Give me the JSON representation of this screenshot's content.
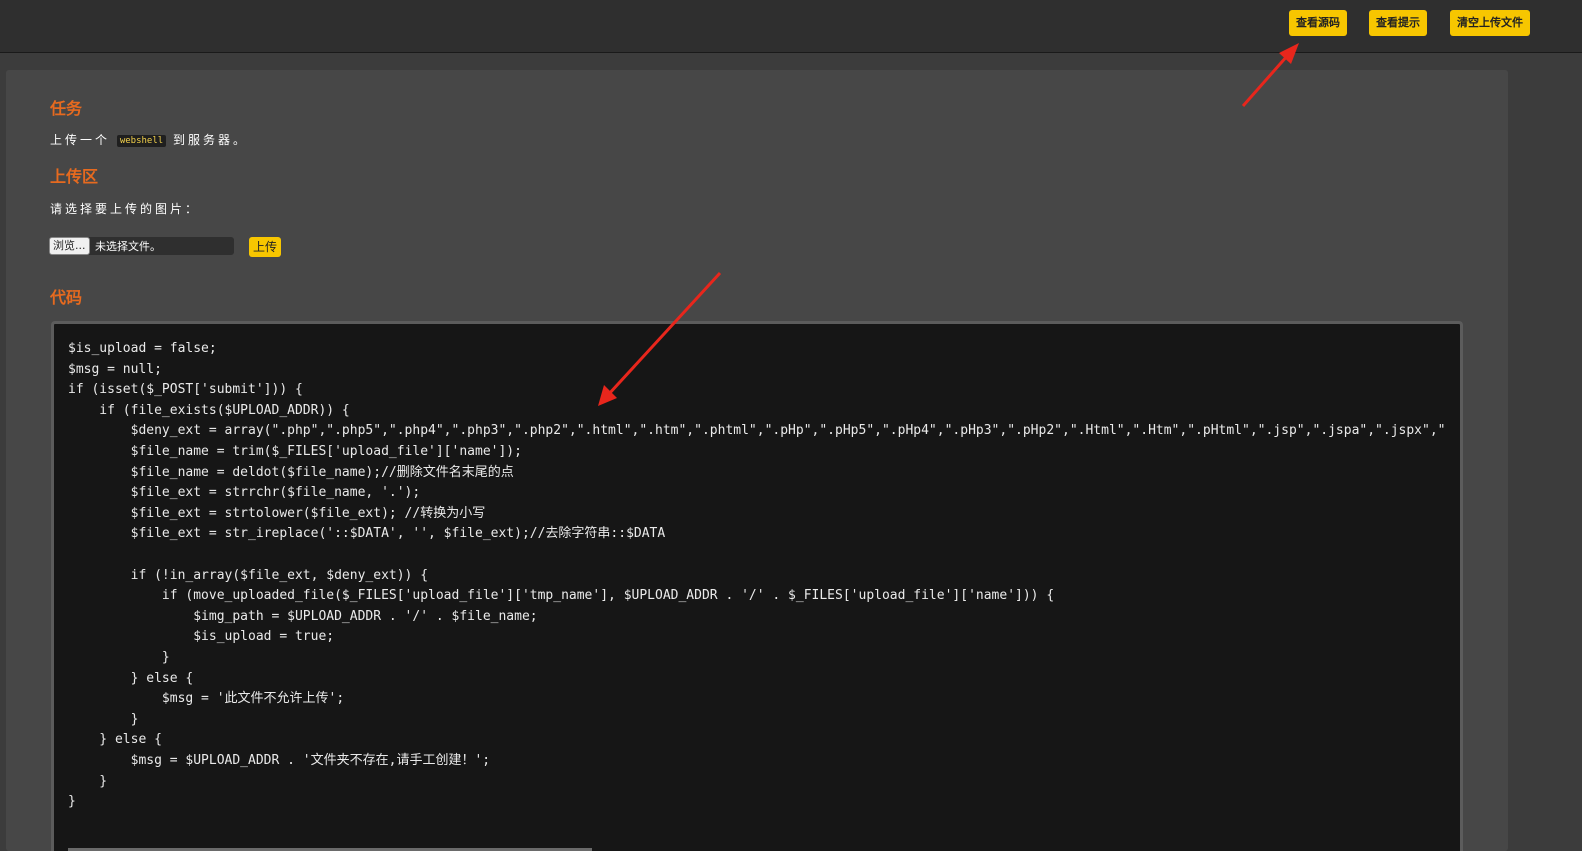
{
  "toolbar": {
    "view_source": "查看源码",
    "view_hint": "查看提示",
    "clear_uploads": "清空上传文件"
  },
  "task": {
    "heading": "任务",
    "text_before": "上传一个",
    "code_word": "webshell",
    "text_after": "到服务器。"
  },
  "upload": {
    "heading": "上传区",
    "instruction": "请选择要上传的图片：",
    "browse_label": "浏览...",
    "no_file_label": "未选择文件。",
    "submit_label": "上传"
  },
  "code": {
    "heading": "代码",
    "lines": [
      "$is_upload = false;",
      "$msg = null;",
      "if (isset($_POST['submit'])) {",
      "    if (file_exists($UPLOAD_ADDR)) {",
      "        $deny_ext = array(\".php\",\".php5\",\".php4\",\".php3\",\".php2\",\".html\",\".htm\",\".phtml\",\".pHp\",\".pHp5\",\".pHp4\",\".pHp3\",\".pHp2\",\".Html\",\".Htm\",\".pHtml\",\".jsp\",\".jspa\",\".jspx\",\"",
      "        $file_name = trim($_FILES['upload_file']['name']);",
      "        $file_name = deldot($file_name);//删除文件名末尾的点",
      "        $file_ext = strrchr($file_name, '.');",
      "        $file_ext = strtolower($file_ext); //转换为小写",
      "        $file_ext = str_ireplace('::$DATA', '', $file_ext);//去除字符串::$DATA",
      "",
      "        if (!in_array($file_ext, $deny_ext)) {",
      "            if (move_uploaded_file($_FILES['upload_file']['tmp_name'], $UPLOAD_ADDR . '/' . $_FILES['upload_file']['name'])) {",
      "                $img_path = $UPLOAD_ADDR . '/' . $file_name;",
      "                $is_upload = true;",
      "            }",
      "        } else {",
      "            $msg = '此文件不允许上传';",
      "        }",
      "    } else {",
      "        $msg = $UPLOAD_ADDR . '文件夹不存在,请手工创建！';",
      "    }",
      "}"
    ]
  },
  "colors": {
    "accent": "#f7c600",
    "heading": "#e66a1f",
    "annotation_arrow": "#e8261c"
  }
}
